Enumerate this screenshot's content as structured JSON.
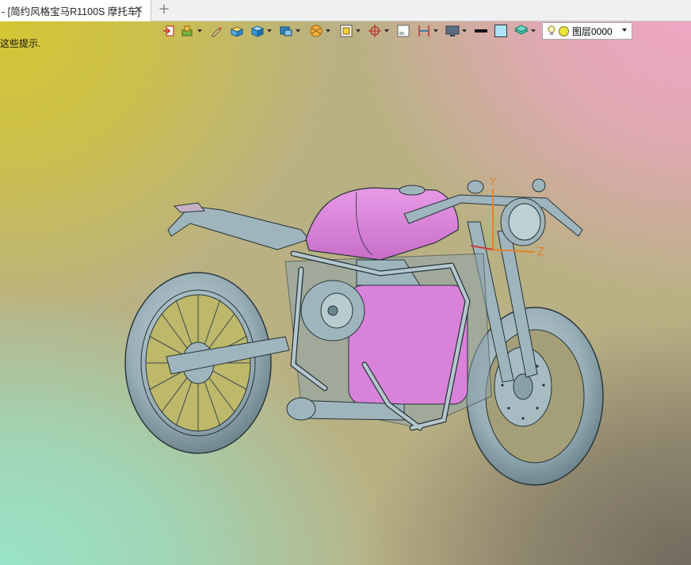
{
  "tab": {
    "title": "- [简约风格宝马R1100S 摩托车]",
    "close_glyph": "✕",
    "new_tab_glyph": "+"
  },
  "hint": {
    "text": "这些提示."
  },
  "toolbar": {
    "items": [
      {
        "icon": "exit-icon"
      },
      {
        "icon": "insert-component-icon"
      },
      {
        "icon": "pen-icon"
      },
      {
        "icon": "add-box-icon"
      },
      {
        "icon": "box-view-icon"
      },
      {
        "icon": "render-mode-icon"
      },
      {
        "icon": "section-view-icon"
      },
      {
        "icon": "frame-icon"
      },
      {
        "icon": "target-icon"
      },
      {
        "icon": "panel-icon"
      },
      {
        "icon": "measure-icon"
      },
      {
        "icon": "monitor-icon"
      },
      {
        "icon": "line-style-icon"
      },
      {
        "icon": "color-swatch-icon"
      },
      {
        "icon": "layers-icon"
      }
    ],
    "layer": {
      "value": "图层0000"
    }
  },
  "viewport": {
    "axes": {
      "y_label": "Y",
      "z_label": "Z"
    },
    "colors": {
      "gradient_top_left": "#d4c634",
      "gradient_top_right": "#f0a6c6",
      "gradient_bottom_left": "#98e3c8",
      "gradient_bottom_right": "#73695f",
      "model_body": "#9fb5bd",
      "model_tank": "#d982d9",
      "axis_color": "#e3822a"
    }
  }
}
